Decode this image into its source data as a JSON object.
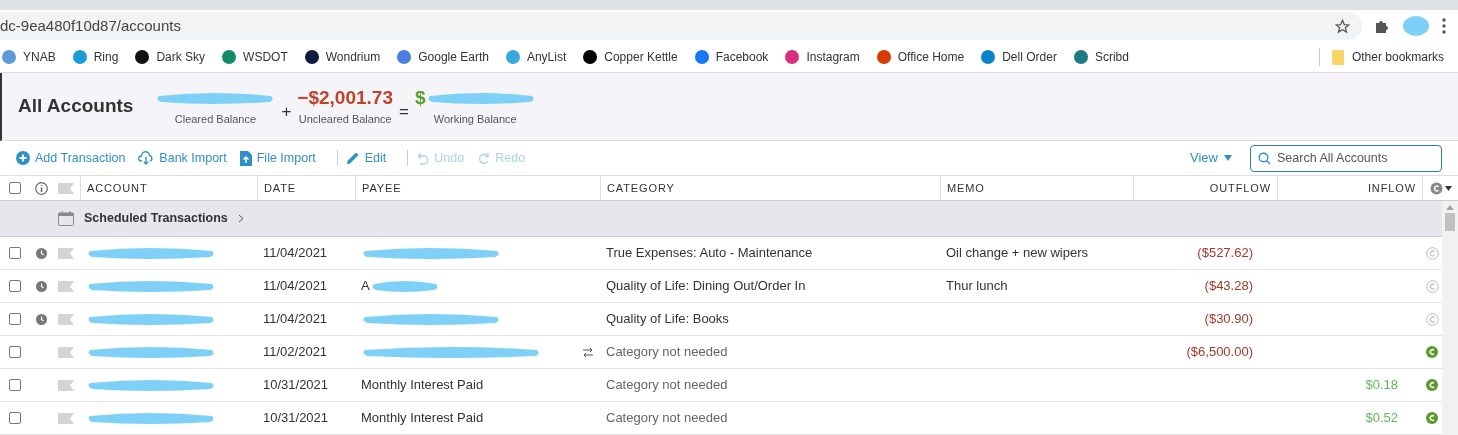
{
  "browser": {
    "url": "dc-9ea480f10d87/accounts",
    "bookmarks": [
      {
        "label": "YNAB",
        "color": "#5b9bd5"
      },
      {
        "label": "Ring",
        "color": "#1c9ad6"
      },
      {
        "label": "Dark Sky",
        "color": "#111111"
      },
      {
        "label": "WSDOT",
        "color": "#138a6b"
      },
      {
        "label": "Wondrium",
        "color": "#0d1b3e"
      },
      {
        "label": "Google Earth",
        "color": "#4a7fe0"
      },
      {
        "label": "AnyList",
        "color": "#3ba7e0"
      },
      {
        "label": "Copper Kettle",
        "color": "#000000"
      },
      {
        "label": "Facebook",
        "color": "#1877f2"
      },
      {
        "label": "Instagram",
        "color": "#d6307a"
      },
      {
        "label": "Office Home",
        "color": "#d83b01"
      },
      {
        "label": "Dell Order",
        "color": "#0a84c8"
      },
      {
        "label": "Scribd",
        "color": "#1e7b85"
      }
    ],
    "other_bookmarks": "Other bookmarks"
  },
  "header": {
    "title": "All Accounts",
    "balances": [
      {
        "label": "Cleared Balance",
        "redacted": true
      },
      {
        "operator": "+",
        "amount": "−$2,001.73",
        "label": "Uncleared Balance",
        "redacted": false
      },
      {
        "operator": "=",
        "amount": "$",
        "label": "Working Balance",
        "redacted": true
      }
    ]
  },
  "toolbar": {
    "actions": [
      {
        "label": "Add Transaction",
        "kind": "add",
        "disabled": false
      },
      {
        "label": "Bank Import",
        "kind": "cloud",
        "disabled": false
      },
      {
        "label": "File Import",
        "kind": "file",
        "disabled": false
      },
      {
        "label": "Edit",
        "kind": "edit",
        "disabled": false
      },
      {
        "label": "Undo",
        "kind": "undo",
        "disabled": true
      },
      {
        "label": "Redo",
        "kind": "redo",
        "disabled": true
      }
    ],
    "view": "View",
    "search": {
      "placeholder": "Search All Accounts"
    }
  },
  "table": {
    "columns": [
      "ACCOUNT",
      "DATE",
      "PAYEE",
      "CATEGORY",
      "MEMO",
      "OUTFLOW",
      "INFLOW"
    ],
    "select_all": {
      "checked": false
    },
    "scheduled_label": "Scheduled Transactions",
    "rows": [
      {
        "checked": false,
        "scheduled": true,
        "date": "11/04/2021",
        "payee": "",
        "transfer": false,
        "category": "True Expenses: Auto - Maintenance",
        "category_needed": true,
        "memo": "Oil change + new wipers",
        "outflow": "($527.62)",
        "inflow": "",
        "cleared": false
      },
      {
        "checked": false,
        "scheduled": true,
        "date": "11/04/2021",
        "payee": "A",
        "transfer": false,
        "category": "Quality of Life: Dining Out/Order In",
        "category_needed": true,
        "memo": "Thur lunch",
        "outflow": "($43.28)",
        "inflow": "",
        "cleared": false
      },
      {
        "checked": false,
        "scheduled": true,
        "date": "11/04/2021",
        "payee": "",
        "transfer": false,
        "category": "Quality of Life: Books",
        "category_needed": true,
        "memo": "",
        "outflow": "($30.90)",
        "inflow": "",
        "cleared": false
      },
      {
        "checked": false,
        "scheduled": false,
        "date": "11/02/2021",
        "payee": "",
        "transfer": true,
        "category": "Category not needed",
        "category_needed": false,
        "memo": "",
        "outflow": "($6,500.00)",
        "inflow": "",
        "cleared": true
      },
      {
        "checked": false,
        "scheduled": false,
        "date": "10/31/2021",
        "payee": "Monthly Interest Paid",
        "transfer": false,
        "category": "Category not needed",
        "category_needed": false,
        "memo": "",
        "outflow": "",
        "inflow": "$0.18",
        "cleared": true
      },
      {
        "checked": false,
        "scheduled": false,
        "date": "10/31/2021",
        "payee": "Monthly Interest Paid",
        "transfer": false,
        "category": "Category not needed",
        "category_needed": false,
        "memo": "",
        "outflow": "",
        "inflow": "$0.52",
        "cleared": true
      }
    ]
  }
}
